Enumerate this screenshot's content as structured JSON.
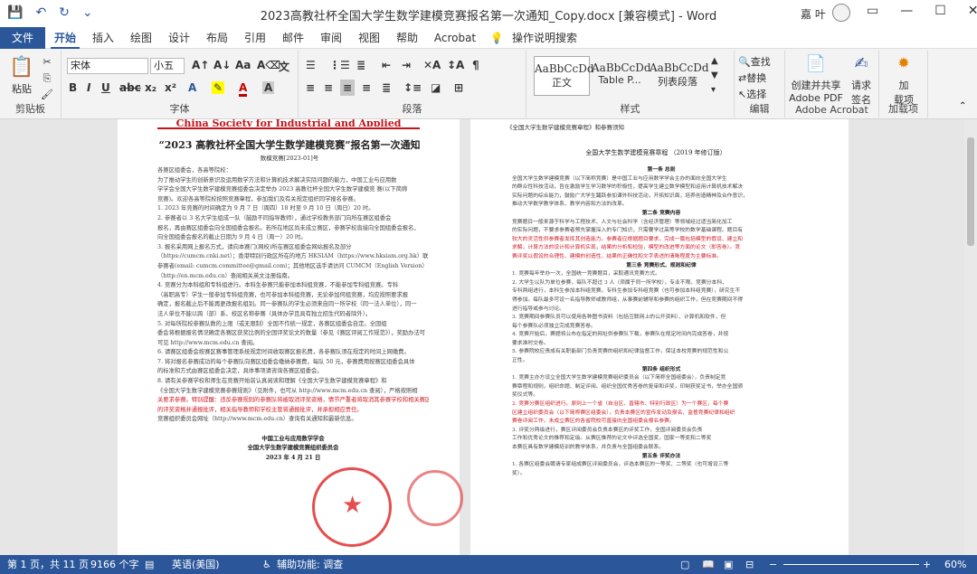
{
  "window": {
    "title": "2023高教社杯全国大学生数学建模竞赛报名第一次通知_Copy.docx [兼容模式] - Word",
    "user": "嘉 叶"
  },
  "tabs": [
    "文件",
    "开始",
    "插入",
    "绘图",
    "设计",
    "布局",
    "引用",
    "邮件",
    "审阅",
    "视图",
    "帮助",
    "Acrobat",
    "操作说明搜索"
  ],
  "ribbon": {
    "clipboard": {
      "paste": "粘贴",
      "label": "剪贴板"
    },
    "font": {
      "name": "宋体",
      "size": "小五",
      "label": "字体"
    },
    "paragraph": {
      "label": "段落"
    },
    "styles": {
      "label": "样式",
      "items": [
        {
          "sample": "AaBbCcDd",
          "name": "正文"
        },
        {
          "sample": "AaBbCcDd",
          "name": "Table P..."
        },
        {
          "sample": "AaBbCcDd",
          "name": "列表段落"
        }
      ]
    },
    "editing": {
      "find": "查找",
      "replace": "替换",
      "select": "选择",
      "label": "编辑"
    },
    "acrobat": {
      "create": "创建并共享",
      "create2": "Adobe PDF",
      "request": "请求",
      "request2": "签名",
      "label": "Adobe Acrobat"
    },
    "addins": {
      "load": "加",
      "load2": "载项",
      "label": "加载项"
    }
  },
  "left_page": {
    "header_red": "China Society for Industrial and Applied Mathematics",
    "title": "“2023 高教社杯全国大学生数学建模竞赛”报名第一次通知",
    "doc_no": "数模竞赛[2023-01]号",
    "lines": [
      {
        "t": "各赛区组委会，各高等院校：",
        "c": ""
      },
      {
        "t": "为了推动学生的创新意识及运用数学方法和计算机技术解决实际问题的能力，中国工业与应用数",
        "c": ""
      },
      {
        "t": "学学会全国大学生数学建模竞赛组委会决定举办 2023 高教社杯全国大学生数学建模竞    赛(以下简称",
        "c": ""
      },
      {
        "t": "竞赛)。欢迎各高等院校按照竞赛章程，参加我们及有关规定组织同学报名参赛。",
        "c": ""
      },
      {
        "t": "1. 2023 年竞赛的时间确定为 9 月 7 日（周四）18 时至 9 月 10 日（周日）20 时。",
        "c": ""
      },
      {
        "t": "2. 参赛者以 3 名大学生组成一队（鼓励不同指导教师），通过学校教务部门向所在赛区组委会",
        "c": ""
      },
      {
        "t": "报名，再由赛区组委会向全国组委会报名。若所在地区尚未成立赛区，参赛学校直接向全国组委会报名，",
        "c": ""
      },
      {
        "t": "向全国组委会报名的截止日期为 9 月 4 日（周一）20 时。",
        "c": ""
      },
      {
        "t": "3. 报名采用网上报名方式，请向本赛门(网校)所在赛区组委会网站报名及部分",
        "c": ""
      },
      {
        "t": "（https://cumcm.cnki.net）；香港特别行政区所在的地方 HKSIAM（https://www.hksiam.org.hk）联系",
        "c": ""
      },
      {
        "t": "参赛者(email: cumcm.committee@gmail.com)；其他地区选手请访问 CUMCM（English Version）",
        "c": ""
      },
      {
        "t": "（http://en.mcm.edu.cn）查阅相关英文注册指南。",
        "c": ""
      },
      {
        "t": "4. 竞赛分为本科组和专科组进行。本科生参赛只能参加本科组竞赛，不能参加专科组竞赛。专科",
        "c": ""
      },
      {
        "t": "（高职高专）学生一般参加专科组竞赛，也可参加本科组竞赛，无论参加何组竞赛，均应按照要求报",
        "c": ""
      },
      {
        "t": "确定，报名截止后不能再更改报名组别。同一参赛队的学生必须来自同一所学校（同一法人单位），同一",
        "c": ""
      },
      {
        "t": "法人单位不能以跨（部）系、校区名称参赛（具体办学且具有独立招生代码者除外）。",
        "c": ""
      },
      {
        "t": "5. 对每所院校参赛队数的上限（或无限制）全国不作统一规定，各赛区组委会自定。全国组",
        "c": ""
      },
      {
        "t": "委会将根据报名情况确定各赛区获奖比例的全国评奖论文的数量（参见《赛区评阅工作规范》），奖励办法可",
        "c": ""
      },
      {
        "t": "可见 http://www.mcm.edu.cn 查阅。",
        "c": ""
      },
      {
        "t": "6. 请赛区组委会按赛区赛事管理系统规定时间收取赛区报名费，各参赛队须在规定的时间上网缴费。",
        "c": ""
      },
      {
        "t": "7. 将对报名参赛成功的每个参赛队向赛区组委会缴纳参赛费，每队 50 元，参赛费用按赛区组委会具体",
        "c": ""
      },
      {
        "t": "的标准和方式由赛区组委会决定，具体事项请咨询各赛区组委会。",
        "c": ""
      },
      {
        "t": "8. 请有关参赛学校和师生在竞赛开始前认真阅读和理解《全国大学生数学建模竞赛章程》和",
        "c": ""
      },
      {
        "t": "《全国大学生数学建模竞赛参赛规则》（见附件，也可从 http://www.mcm.edu.cn 查阅），严格按照相",
        "c": ""
      },
      {
        "t": "关要求参赛。特别提醒：违反参赛规则的参赛队将被取消评奖资格，情节严重者将取消其参赛学校和相关赛区",
        "c": "red"
      },
      {
        "t": "的评奖资格并通报批评，相关指导教师和学校主管将通报批评，并承担相应责任。",
        "c": "red"
      },
      {
        "t": "竞赛组织委员会网址（http://www.mcm.edu.cn）查询有关通知和最新信息。",
        "c": ""
      },
      {
        "t": "",
        "c": ""
      },
      {
        "t": "中国工业与应用数学学会",
        "c": "center"
      },
      {
        "t": "全国大学生数学建模竞赛组织委员会",
        "c": "center"
      },
      {
        "t": "2023 年 4 月 21 日",
        "c": "center"
      }
    ]
  },
  "right_page": {
    "top_note": "《全国大学生数学建模竞赛章程》和参赛须知",
    "title": "全国大学生数学建模竞赛章程   （2019 年修订版）",
    "lines": [
      {
        "t": "第一条  总则",
        "c": "center"
      },
      {
        "t": "全国大学生数学建模竞赛（以下简称竞赛）是中国工业与应用数学学会主办的面向全国大学生",
        "c": ""
      },
      {
        "t": "的群众性科技活动，旨在激励学生学习数学的积极性，提高学生建立数学模型和运用计算机技术解决",
        "c": ""
      },
      {
        "t": "实际问题的综合能力，鼓励广大学生踊跃参加课外科技活动，开拓知识面，培养创造精神及合作意识，",
        "c": ""
      },
      {
        "t": "推动大学数学教学体系、教学内容和方法的改革。",
        "c": ""
      },
      {
        "t": "第二条  竞赛内容",
        "c": "center"
      },
      {
        "t": "竞赛题目一般来源于科学与工程技术、人文与社会科学（含经济管理）等领域经过适当简化加工",
        "c": ""
      },
      {
        "t": "的实际问题，不要求参赛者预先掌握深入的专门知识，只需要学过高等学校的数学基础课程。题目有",
        "c": ""
      },
      {
        "t": "较大的灵活性供参赛者发挥其创造能力。参赛者应根据题目要求，完成一篇包括模型的假设、建立和",
        "c": "red"
      },
      {
        "t": "求解，计算方法的设计和计算机实现，结果的分析和检验，模型的改进等方面的论文（即答卷）。竞",
        "c": "red"
      },
      {
        "t": "赛评奖以假设的合理性、建模的创造性、结果的正确性和文字表述的清晰程度为主要标准。",
        "c": "red"
      },
      {
        "t": "第三条  竞赛形式、规则和纪律",
        "c": "center"
      },
      {
        "t": "1. 竞赛每年举办一次，全国统一竞赛题目，采取通讯竞赛方式。",
        "c": ""
      },
      {
        "t": "2. 大学生以队为单位参赛，每队不超过 3 人（须属于同一所学校），专业不限。竞赛分本科、",
        "c": ""
      },
      {
        "t": "专科两组进行，本科生参加本科组竞赛，专科生参加专科组竞赛（也可参加本科组竞赛），研究生不",
        "c": ""
      },
      {
        "t": "得参加。每队最多可设一名指导教师或教师组，从事赛前辅导和参赛的组织工作，但在竞赛期间不得",
        "c": ""
      },
      {
        "t": "进行指导或参与讨论。",
        "c": ""
      },
      {
        "t": "3. 竞赛期间参赛队员可以使用各种图书资料（包括互联网上的公开资料）、计算机和软件，但",
        "c": ""
      },
      {
        "t": "每个参赛队必须独立完成竞赛答卷。",
        "c": ""
      },
      {
        "t": "4. 竞赛开始后，赛题将公布在指定的网址供参赛队下载，参赛队在规定时间内完成答卷，并按",
        "c": ""
      },
      {
        "t": "要求准时交卷。",
        "c": ""
      },
      {
        "t": "5. 参赛院校应责成有关职能部门负责竞赛的组织和纪律监督工作，保证本校竞赛的规范性和公",
        "c": ""
      },
      {
        "t": "正性。",
        "c": ""
      },
      {
        "t": "第四条  组织形式",
        "c": "center"
      },
      {
        "t": "1. 竞赛主办方设立全国大学生数学建模竞赛组织委员会（以下简称全国组委会），负责制定竞",
        "c": ""
      },
      {
        "t": "赛章程和规则，组织命题、制定评阅、组织全国优秀答卷的复审和评奖，印制获奖证书，举办全国颁",
        "c": ""
      },
      {
        "t": "奖仪式等。",
        "c": ""
      },
      {
        "t": "2. 竞赛分赛区组织进行。原则上一个省（自治区、直辖市、特别行政区）为一个赛区，每个赛",
        "c": "red"
      },
      {
        "t": "区建立组织委员会（以下简称赛区组委会），负责本赛区的宣传发动及报名、监督竞赛纪律和组织",
        "c": "red"
      },
      {
        "t": "赛卷评阅工作，未成立赛区的各省院校可直接向全国组委会报名参赛。",
        "c": "red"
      },
      {
        "t": "3. 评奖分两级进行，赛区评阅委员会负责本赛区的评奖工作，全国评阅委员会负责",
        "c": ""
      },
      {
        "t": "工作和优秀论文的推荐和定级。从赛区推荐的论文中评选全国奖，国家一等奖和二等奖",
        "c": ""
      },
      {
        "t": "本赛区具有数学建模培训的教学体系，并负责与全国组委会联系。",
        "c": ""
      },
      {
        "t": "第五条  评奖办法",
        "c": "center"
      },
      {
        "t": "1. 各赛区组委会聘请专家组成赛区评阅委员会，评选本赛区的一等奖、二等奖（也可增设三等",
        "c": ""
      },
      {
        "t": "奖）。",
        "c": ""
      }
    ]
  },
  "status": {
    "page": "第 1 页，共 11 页",
    "words": "9166 个字",
    "lang": "英语(美国)",
    "accessibility": "辅助功能: 调查",
    "zoom": "60%"
  }
}
